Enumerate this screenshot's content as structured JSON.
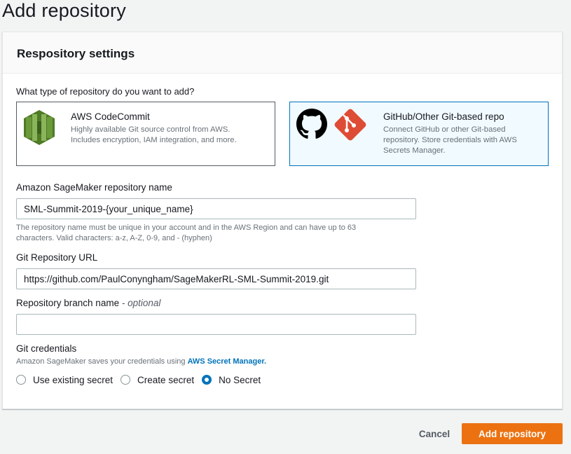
{
  "page": {
    "title": "Add repository"
  },
  "panel": {
    "header": "Respository settings"
  },
  "repo_type": {
    "question": "What type of repository do you want to add?",
    "options": [
      {
        "title": "AWS CodeCommit",
        "description_line1": "Highly available Git source control from AWS.",
        "description_line2": "Includes encryption, IAM integration, and more.",
        "selected": false,
        "icon": "codecommit-icon"
      },
      {
        "title": "GitHub/Other Git-based repo",
        "description_line1": "Connect GitHub or other Git-based",
        "description_line2": "repository. Store credentials with AWS",
        "description_line3": "Secrets Manager.",
        "selected": true,
        "icons": [
          "github-icon",
          "git-icon"
        ]
      }
    ]
  },
  "repo_name": {
    "label": "Amazon SageMaker repository name",
    "value": "SML-Summit-2019-{your_unique_name}",
    "hint_line1": "The repository name must be unique in your account and in the AWS Region and can have up to 63",
    "hint_line2": "characters. Valid characters: a-z, A-Z, 0-9, and - (hyphen)"
  },
  "git_url": {
    "label": "Git Repository URL",
    "value": "https://github.com/PaulConyngham/SageMakerRL-SML-Summit-2019.git"
  },
  "branch": {
    "label": "Repository branch name",
    "optional": "- optional",
    "value": ""
  },
  "credentials": {
    "label": "Git credentials",
    "hint_prefix": "Amazon SageMaker saves your credentials using",
    "hint_link": "AWS Secret Manager.",
    "options": [
      {
        "label": "Use existing secret",
        "checked": false
      },
      {
        "label": "Create secret",
        "checked": false
      },
      {
        "label": "No Secret",
        "checked": true
      }
    ]
  },
  "actions": {
    "cancel": "Cancel",
    "submit": "Add repository"
  },
  "colors": {
    "accent": "#0073bb",
    "primary_button": "#ec7211",
    "codecommit_green": "#6b9a3b",
    "git_red": "#de4c36"
  }
}
